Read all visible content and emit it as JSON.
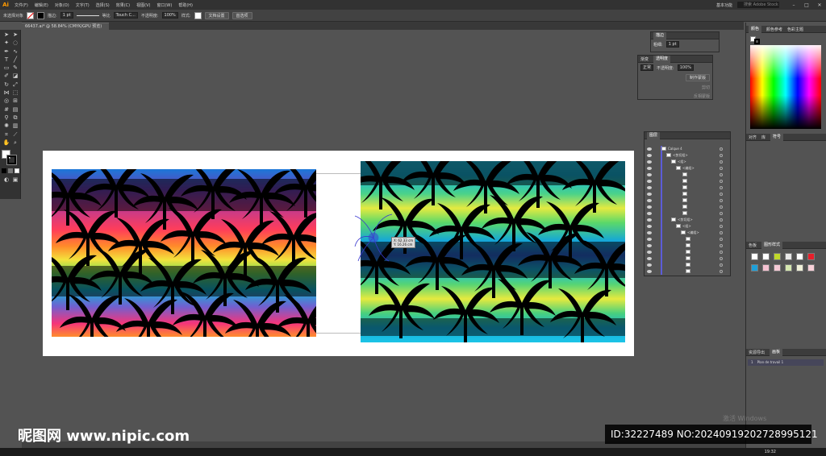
{
  "app": {
    "logo": "Ai",
    "menus": [
      "文件(F)",
      "编辑(E)",
      "对象(O)",
      "文字(T)",
      "选择(S)",
      "效果(C)",
      "视图(V)",
      "窗口(W)",
      "帮助(H)"
    ],
    "workspace": "基本功能",
    "search_placeholder": "搜索 Adobe Stock"
  },
  "control_bar": {
    "selection": "未选择对象",
    "stroke_label": "描边:",
    "stroke_value": "1 pt",
    "brush_label": "等比",
    "brush_name": "Touch C...",
    "opacity_label": "不透明度:",
    "opacity_value": "100%",
    "style_label": "样式:",
    "doc_setup": "文档设置",
    "preferences": "首选项"
  },
  "document_tab": {
    "title": "66437.ai* @ 58.84% (CMYK/GPU 预览)"
  },
  "measure_tooltip": {
    "line1": "X: 62.33 cm",
    "line2": "Y: 16.26 cm"
  },
  "panels": {
    "stroke_panel": {
      "tab": "描边",
      "weight_label": "粗细:",
      "weight_value": "1 pt"
    },
    "transparency_panel": {
      "tabs": [
        "渐变",
        "透明度"
      ],
      "mode": "正常",
      "opacity_label": "不透明度:",
      "opacity_value": "100%",
      "btn": "制作蒙版",
      "check1": "剪切",
      "check2": "反相蒙版"
    },
    "color_panel": {
      "tabs": [
        "颜色",
        "颜色参考",
        "色彩主题"
      ]
    },
    "align_panel": {
      "tabs": [
        "对齐",
        "库",
        "符号"
      ]
    },
    "layers_panel": {
      "tab": "图层",
      "layers": [
        {
          "name": "Calque 4"
        },
        {
          "name": "<剪切组>"
        },
        {
          "name": "<组>"
        },
        {
          "name": "<编组>"
        },
        {
          "name": ""
        },
        {
          "name": ""
        },
        {
          "name": ""
        },
        {
          "name": ""
        },
        {
          "name": ""
        },
        {
          "name": ""
        },
        {
          "name": ""
        },
        {
          "name": "<剪切组>"
        },
        {
          "name": "<组>"
        },
        {
          "name": "<编组>"
        },
        {
          "name": ""
        },
        {
          "name": ""
        },
        {
          "name": ""
        },
        {
          "name": ""
        },
        {
          "name": ""
        },
        {
          "name": ""
        }
      ],
      "footer": "2 个图层"
    },
    "swatches_panel": {
      "tabs": [
        "色板",
        "图形样式"
      ],
      "colors": [
        "#ffffff",
        "#ffffff",
        "#c0d82a",
        "#e8e8e8",
        "#ffffff",
        "#e81e2a",
        "#1e9fd8",
        "#f4c0d0",
        "#f4c8d4",
        "#d6e8b0",
        "#f0f0d8",
        "#f8d0d8"
      ]
    },
    "artboards_panel": {
      "tabs": [
        "资源导出",
        "画板"
      ],
      "item_num": "1",
      "item_name": "Plan de travail 1"
    }
  },
  "watermark": {
    "left": "昵图网 www.nipic.com",
    "right": "ID:32227489 NO:20240919202728995121",
    "activate": "激活 Windows"
  },
  "taskbar": {
    "clock": "19:32"
  }
}
